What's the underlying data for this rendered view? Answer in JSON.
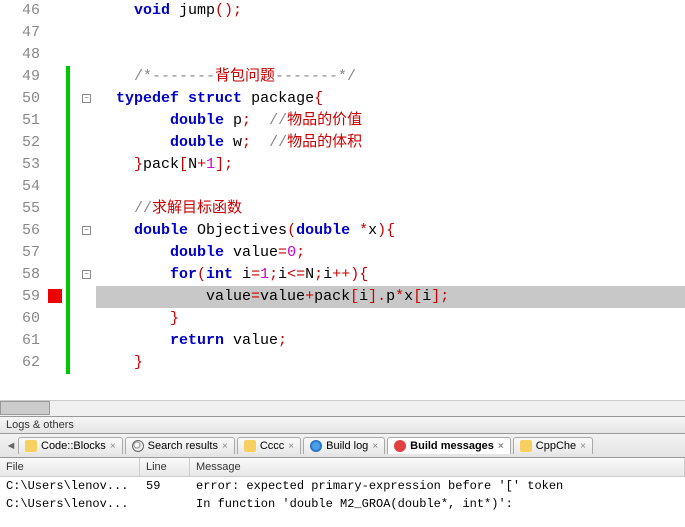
{
  "code": {
    "lines": [
      {
        "n": 46,
        "bar": "",
        "fold": "",
        "marker": "",
        "tokens": [
          {
            "t": "    ",
            "c": ""
          },
          {
            "t": "void",
            "c": "kw"
          },
          {
            "t": " jump",
            "c": "ident"
          },
          {
            "t": "();",
            "c": "op"
          }
        ]
      },
      {
        "n": 47,
        "bar": "",
        "fold": "",
        "marker": "",
        "tokens": []
      },
      {
        "n": 48,
        "bar": "",
        "fold": "",
        "marker": "",
        "tokens": []
      },
      {
        "n": 49,
        "bar": "green",
        "fold": "",
        "marker": "",
        "tokens": [
          {
            "t": "    ",
            "c": ""
          },
          {
            "t": "/*-------",
            "c": "comment"
          },
          {
            "t": "背包问题",
            "c": "comment-cn"
          },
          {
            "t": "-------*/",
            "c": "comment"
          }
        ]
      },
      {
        "n": 50,
        "bar": "green",
        "fold": "minus",
        "marker": "",
        "tokens": [
          {
            "t": "  ",
            "c": ""
          },
          {
            "t": "typedef",
            "c": "kw"
          },
          {
            "t": " ",
            "c": ""
          },
          {
            "t": "struct",
            "c": "kw"
          },
          {
            "t": " package",
            "c": "ident"
          },
          {
            "t": "{",
            "c": "op"
          }
        ]
      },
      {
        "n": 51,
        "bar": "green",
        "fold": "",
        "marker": "",
        "tokens": [
          {
            "t": "        ",
            "c": ""
          },
          {
            "t": "double",
            "c": "kw"
          },
          {
            "t": " p",
            "c": "ident"
          },
          {
            "t": ";",
            "c": "op"
          },
          {
            "t": "  ",
            "c": ""
          },
          {
            "t": "//",
            "c": "comment"
          },
          {
            "t": "物品的价值",
            "c": "comment-cn"
          }
        ]
      },
      {
        "n": 52,
        "bar": "green",
        "fold": "",
        "marker": "",
        "tokens": [
          {
            "t": "        ",
            "c": ""
          },
          {
            "t": "double",
            "c": "kw"
          },
          {
            "t": " w",
            "c": "ident"
          },
          {
            "t": ";",
            "c": "op"
          },
          {
            "t": "  ",
            "c": ""
          },
          {
            "t": "//",
            "c": "comment"
          },
          {
            "t": "物品的体积",
            "c": "comment-cn"
          }
        ]
      },
      {
        "n": 53,
        "bar": "green",
        "fold": "",
        "marker": "",
        "tokens": [
          {
            "t": "    ",
            "c": ""
          },
          {
            "t": "}",
            "c": "op"
          },
          {
            "t": "pack",
            "c": "ident"
          },
          {
            "t": "[",
            "c": "op"
          },
          {
            "t": "N",
            "c": "ident"
          },
          {
            "t": "+",
            "c": "op"
          },
          {
            "t": "1",
            "c": "num"
          },
          {
            "t": "];",
            "c": "op"
          }
        ]
      },
      {
        "n": 54,
        "bar": "green",
        "fold": "",
        "marker": "",
        "tokens": []
      },
      {
        "n": 55,
        "bar": "green",
        "fold": "",
        "marker": "",
        "tokens": [
          {
            "t": "    ",
            "c": ""
          },
          {
            "t": "//",
            "c": "comment"
          },
          {
            "t": "求解目标函数",
            "c": "comment-cn"
          }
        ]
      },
      {
        "n": 56,
        "bar": "green",
        "fold": "minus",
        "marker": "",
        "tokens": [
          {
            "t": "    ",
            "c": ""
          },
          {
            "t": "double",
            "c": "kw"
          },
          {
            "t": " Objectives",
            "c": "ident"
          },
          {
            "t": "(",
            "c": "op"
          },
          {
            "t": "double",
            "c": "kw"
          },
          {
            "t": " ",
            "c": ""
          },
          {
            "t": "*",
            "c": "op"
          },
          {
            "t": "x",
            "c": "ident"
          },
          {
            "t": "){",
            "c": "op"
          }
        ]
      },
      {
        "n": 57,
        "bar": "green",
        "fold": "",
        "marker": "",
        "tokens": [
          {
            "t": "        ",
            "c": ""
          },
          {
            "t": "double",
            "c": "kw"
          },
          {
            "t": " value",
            "c": "ident"
          },
          {
            "t": "=",
            "c": "op"
          },
          {
            "t": "0",
            "c": "num"
          },
          {
            "t": ";",
            "c": "op"
          }
        ]
      },
      {
        "n": 58,
        "bar": "green",
        "fold": "minus",
        "marker": "",
        "tokens": [
          {
            "t": "        ",
            "c": ""
          },
          {
            "t": "for",
            "c": "kw"
          },
          {
            "t": "(",
            "c": "op"
          },
          {
            "t": "int",
            "c": "kw"
          },
          {
            "t": " i",
            "c": "ident"
          },
          {
            "t": "=",
            "c": "op"
          },
          {
            "t": "1",
            "c": "num"
          },
          {
            "t": ";",
            "c": "op"
          },
          {
            "t": "i",
            "c": "ident"
          },
          {
            "t": "<=",
            "c": "op"
          },
          {
            "t": "N",
            "c": "ident"
          },
          {
            "t": ";",
            "c": "op"
          },
          {
            "t": "i",
            "c": "ident"
          },
          {
            "t": "++){",
            "c": "op"
          }
        ]
      },
      {
        "n": 59,
        "bar": "green",
        "fold": "",
        "marker": "red",
        "highlight": true,
        "tokens": [
          {
            "t": "            value",
            "c": "ident"
          },
          {
            "t": "=",
            "c": "op"
          },
          {
            "t": "value",
            "c": "ident"
          },
          {
            "t": "+",
            "c": "op"
          },
          {
            "t": "pack",
            "c": "ident"
          },
          {
            "t": "[",
            "c": "op"
          },
          {
            "t": "i",
            "c": "ident"
          },
          {
            "t": "].",
            "c": "op"
          },
          {
            "t": "p",
            "c": "ident"
          },
          {
            "t": "*",
            "c": "op"
          },
          {
            "t": "x",
            "c": "ident"
          },
          {
            "t": "[",
            "c": "op"
          },
          {
            "t": "i",
            "c": "ident"
          },
          {
            "t": "];",
            "c": "op"
          }
        ]
      },
      {
        "n": 60,
        "bar": "green",
        "fold": "",
        "marker": "",
        "tokens": [
          {
            "t": "        ",
            "c": ""
          },
          {
            "t": "}",
            "c": "op"
          }
        ]
      },
      {
        "n": 61,
        "bar": "green",
        "fold": "",
        "marker": "",
        "tokens": [
          {
            "t": "        ",
            "c": ""
          },
          {
            "t": "return",
            "c": "kw"
          },
          {
            "t": " value",
            "c": "ident"
          },
          {
            "t": ";",
            "c": "op"
          }
        ]
      },
      {
        "n": 62,
        "bar": "green",
        "fold": "",
        "marker": "",
        "tokens": [
          {
            "t": "    ",
            "c": ""
          },
          {
            "t": "}",
            "c": "op"
          }
        ]
      }
    ]
  },
  "panel_label": "Logs & others",
  "tabs": [
    {
      "label": "Code::Blocks",
      "icon": "ico-cb",
      "active": false
    },
    {
      "label": "Search results",
      "icon": "ico-search",
      "active": false
    },
    {
      "label": "Cccc",
      "icon": "ico-cccc",
      "active": false
    },
    {
      "label": "Build log",
      "icon": "ico-log",
      "active": false
    },
    {
      "label": "Build messages",
      "icon": "ico-msg",
      "active": true
    },
    {
      "label": "CppChe",
      "icon": "ico-cb",
      "active": false
    }
  ],
  "messages": {
    "headers": {
      "file": "File",
      "line": "Line",
      "msg": "Message"
    },
    "rows": [
      {
        "file": "C:\\Users\\lenov...",
        "line": "59",
        "msg": "error: expected primary-expression before '[' token"
      },
      {
        "file": "C:\\Users\\lenov...",
        "line": "",
        "msg": "In function 'double M2_GROA(double*, int*)':"
      }
    ]
  }
}
